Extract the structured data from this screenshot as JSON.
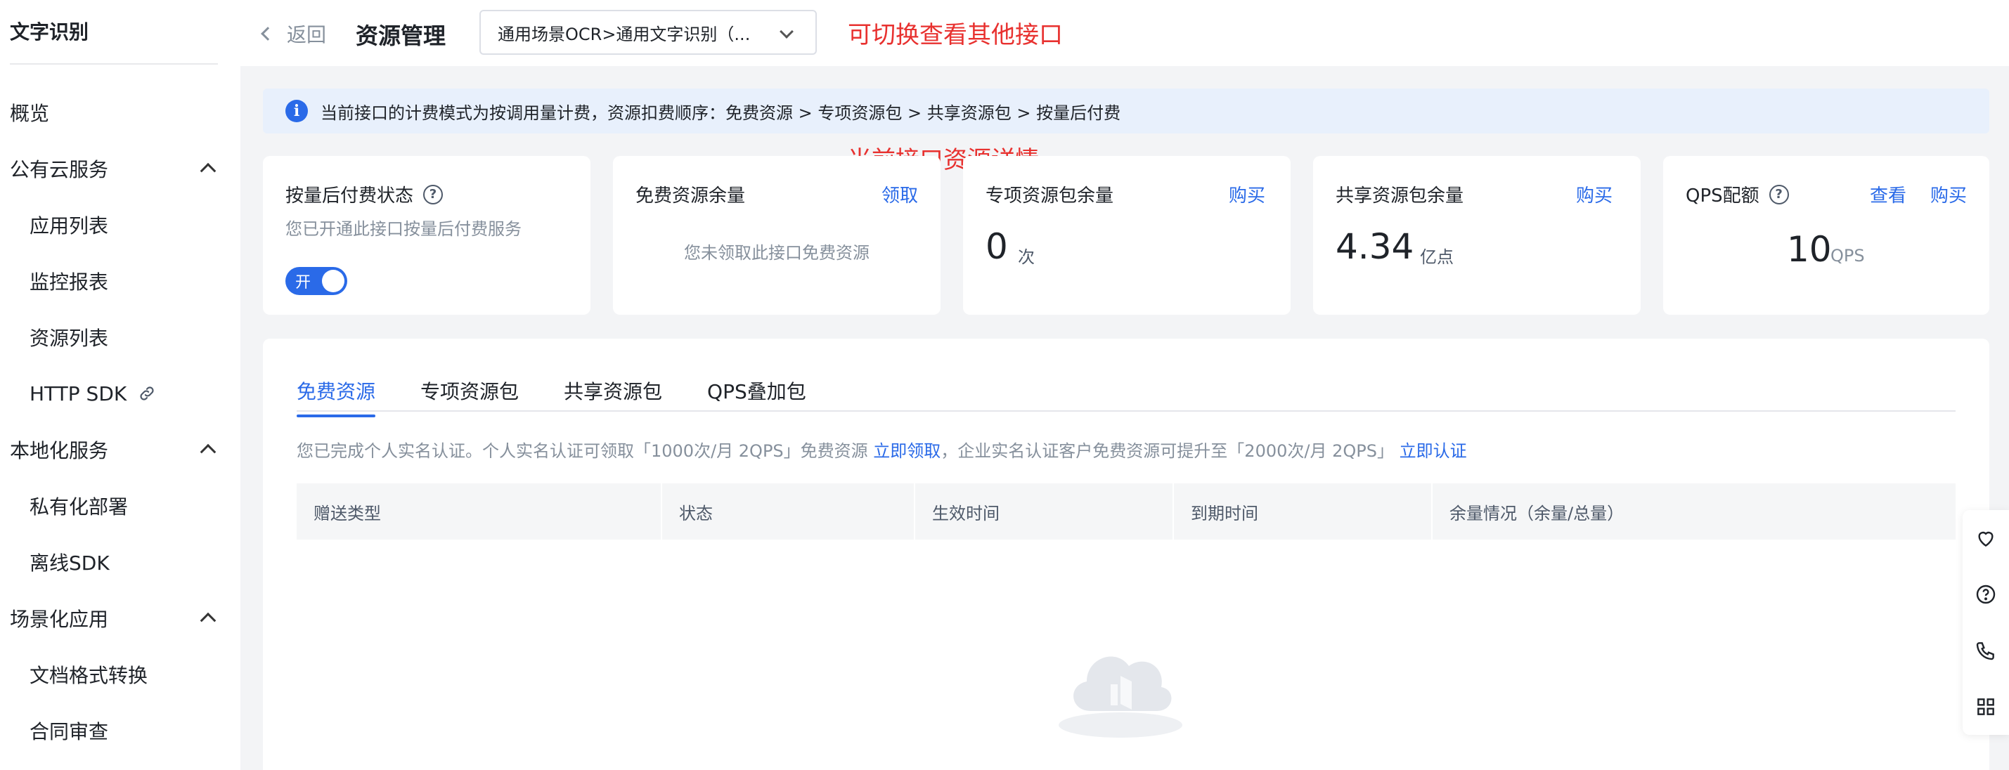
{
  "sidebar": {
    "title": "文字识别",
    "items": [
      {
        "label": "概览",
        "level": "top"
      },
      {
        "label": "公有云服务",
        "level": "top",
        "expandable": true
      },
      {
        "label": "应用列表",
        "level": "sub"
      },
      {
        "label": "监控报表",
        "level": "sub"
      },
      {
        "label": "资源列表",
        "level": "sub"
      },
      {
        "label": "HTTP SDK",
        "level": "sub",
        "icon": "link-icon"
      },
      {
        "label": "本地化服务",
        "level": "top",
        "expandable": true
      },
      {
        "label": "私有化部署",
        "level": "sub"
      },
      {
        "label": "离线SDK",
        "level": "sub"
      },
      {
        "label": "场景化应用",
        "level": "top",
        "expandable": true
      },
      {
        "label": "文档格式转换",
        "level": "sub"
      },
      {
        "label": "合同审查",
        "level": "sub"
      }
    ]
  },
  "header": {
    "back_label": "返回",
    "title": "资源管理",
    "api_select_value": "通用场景OCR>通用文字识别（..."
  },
  "annotations": {
    "switch_api": "可切换查看其他接口",
    "current_detail": "当前接口资源详情"
  },
  "info_bar": {
    "text": "当前接口的计费模式为按调用量计费，资源扣费顺序：免费资源 > 专项资源包 > 共享资源包 > 按量后付费"
  },
  "cards": {
    "postpaid": {
      "title": "按量后付费状态",
      "subtitle": "您已开通此接口按量后付费服务",
      "toggle_label": "开",
      "toggle_on": true
    },
    "free": {
      "title": "免费资源余量",
      "action": "领取",
      "empty_text": "您未领取此接口免费资源"
    },
    "special": {
      "title": "专项资源包余量",
      "action": "购买",
      "value": "0",
      "unit": "次"
    },
    "shared": {
      "title": "共享资源包余量",
      "action": "购买",
      "value": "4.34",
      "unit": "亿点"
    },
    "qps": {
      "title": "QPS配额",
      "action_view": "查看",
      "action_buy": "购买",
      "value": "10",
      "unit": "QPS"
    }
  },
  "tabs": [
    {
      "label": "免费资源",
      "active": true
    },
    {
      "label": "专项资源包",
      "active": false
    },
    {
      "label": "共享资源包",
      "active": false
    },
    {
      "label": "QPS叠加包",
      "active": false
    }
  ],
  "notice": {
    "part1": "您已完成个人实名认证。个人实名认证可领取「1000次/月 2QPS」免费资源 ",
    "link1": "立即领取",
    "part2": "，企业实名认证客户免费资源可提升至「2000次/月 2QPS」 ",
    "link2": "立即认证"
  },
  "table": {
    "columns": [
      "赠送类型",
      "状态",
      "生效时间",
      "到期时间",
      "余量情况（余量/总量）"
    ]
  },
  "colors": {
    "primary": "#2a6ae8",
    "annotation_red": "#e8312f",
    "info_bg": "#e8f0fc"
  }
}
